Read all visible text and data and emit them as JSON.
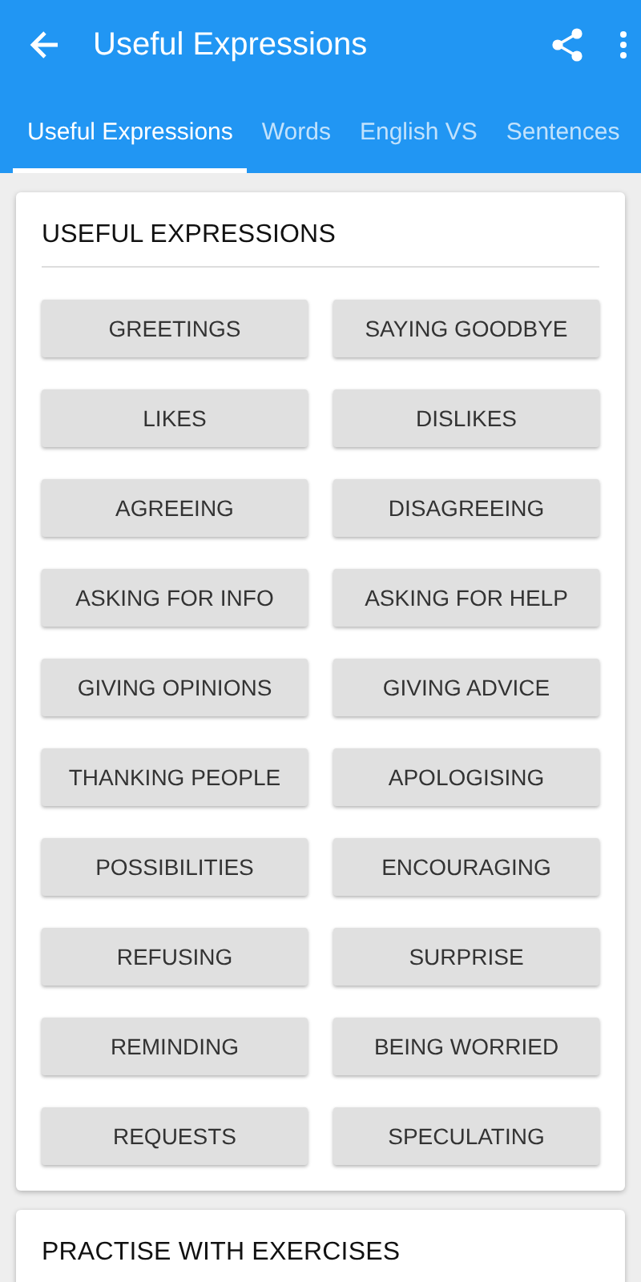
{
  "app_bar": {
    "title": "Useful Expressions"
  },
  "tabs": [
    {
      "label": "Useful Expressions",
      "selected": true
    },
    {
      "label": "Words",
      "selected": false
    },
    {
      "label": "English VS",
      "selected": false
    },
    {
      "label": "Sentences",
      "selected": false
    }
  ],
  "cards": [
    {
      "title": "USEFUL EXPRESSIONS",
      "buttons": [
        "GREETINGS",
        "SAYING GOODBYE",
        "LIKES",
        "DISLIKES",
        "AGREEING",
        "DISAGREEING",
        "ASKING FOR INFO",
        "ASKING FOR HELP",
        "GIVING OPINIONS",
        "GIVING ADVICE",
        "THANKING PEOPLE",
        "APOLOGISING",
        "POSSIBILITIES",
        "ENCOURAGING",
        "REFUSING",
        "SURPRISE",
        "REMINDING",
        "BEING WORRIED",
        "REQUESTS",
        "SPECULATING"
      ]
    },
    {
      "title": "PRACTISE WITH EXERCISES"
    }
  ]
}
